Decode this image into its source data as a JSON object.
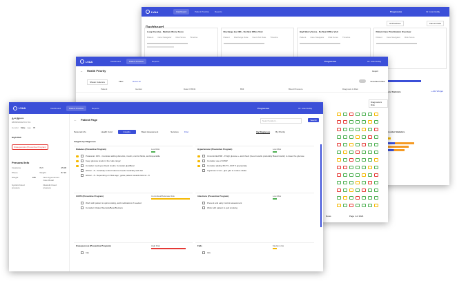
{
  "brand": "LVAA",
  "nav": {
    "dashboard": "Dashboard",
    "patient_practice": "Patient Practice",
    "reports": "Reports"
  },
  "org": {
    "name": "Progressive",
    "sub": "Progressive clinic"
  },
  "user": "Dr. Lisa Cuddy",
  "dashboard": {
    "title": "Dashboard",
    "filter": "All Practices",
    "btn": "Cancel Visits",
    "cards": [
      {
        "title": "Long Overdue - Medium Worry Score",
        "cols": [
          "Patient",
          "Care Navigator",
          "Risk Score",
          "Timeline"
        ]
      },
      {
        "title": "Discharge last 48h - No Next Office Visit",
        "cols": [
          "Patient",
          "Discharge Date",
          "Next Visit Date",
          "Timeline"
        ]
      },
      {
        "title": "High Worry Score - No Next Office Visit",
        "cols": [
          "Patient",
          "Care Navigator",
          "Risk Score",
          "Timeline"
        ]
      },
      {
        "title": "Patient Care Prioritization Overview",
        "cols": [
          "Patient",
          "Care Navigator",
          "Risk Score",
          "Timeline"
        ]
      }
    ],
    "care_stats": "Care Statistics",
    "add_widget": "+ Add Widget",
    "provider_stats": "Provider Statistics"
  },
  "health_priority": {
    "title": "Health Priority",
    "export": "Export",
    "shown_columns": "Shown Columns",
    "filter": "Filter",
    "reset": "Reset all",
    "simulated": "Simulated Value",
    "columns": [
      "Patient",
      "Gender",
      "Date Of Birth",
      "BMI",
      "Blood Pressure",
      "Diagnosis & Risk"
    ],
    "diag_risk": "Diagnosis & Risk",
    "rows": "Rows",
    "pager": "Page 1 of 1024"
  },
  "patient": {
    "page_title": "Patient Page",
    "search_placeholder": "Search patient...",
    "search_btn": "Search",
    "name": "A** Bl****",
    "id": "#8568520327FC791",
    "gender_label": "Gender",
    "gender": "Male",
    "age_label": "Age",
    "age": "76",
    "risk_label": "High Risk",
    "program": "Osteoporosis (Preventive Program)",
    "personal_info": "Personal Info",
    "info": [
      {
        "k": "Insurance",
        "v": "",
        "k2": "BMI",
        "v2": "25.08"
      },
      {
        "k": "Phone",
        "v": "",
        "k2": "Weight",
        "v2": "87.26"
      },
      {
        "k": "Weight",
        "v": "188",
        "k2": "Next Appointment Care Model",
        "v2": ""
      },
      {
        "k": "Systolic blood pressure",
        "v": "",
        "k2": "Diastolic blood pressure",
        "v2": ""
      }
    ],
    "tabs": [
      "Personal info",
      "Health Card",
      "Insights",
      "Basic Assessment",
      "Services"
    ],
    "tab_filter": "Filter",
    "by_diagnoses": "By Diagnoses",
    "by_priority": "By Priority",
    "insights_title": "Insights by Diagnoses",
    "panels": [
      {
        "title": "Diabetes (Preventive Program)",
        "level": "Low Risk",
        "items": [
          "Potassium 10% - Consider adding diuretics, insulin, control fluids, and Especiallie",
          "Keep glucose levels in the 'safe range'",
          "Consider moving to blood insulin. Consider glaciBanz",
          "HbA1c - 8 - Carefully control Glucose levels medically and diet",
          "HbA1c - 8 - Depending on 'Risk age', guide patient towards HbA1c - 8"
        ],
        "color": "#4caf50"
      },
      {
        "title": "Hypertension (Preventive Program)",
        "level": "Low Risk",
        "items": [
          "Uncontrolled BM - If high glucose + add check (Good results preferably Basal Insulin) to lower the glucose",
          "Consider use of CPAP",
          "Consider adding 5th TC, DOT if appropriate",
          "If glucose is low - give glut to reduce intake"
        ],
        "color": "#4caf50"
      },
      {
        "title": "COPD (Preventive Program)",
        "level": "Controlled/Moderate Risk",
        "items": [
          "Work with patient to quit smoking, add medications if needed",
          "Consider Inhaled Steroids/Beta Blockers"
        ],
        "color": "#f5b800"
      },
      {
        "title": "Infections (Preventive Program)",
        "level": "Low Risk",
        "items": [
          "Prevent and early control assessment",
          "Work with patient to quit smoking"
        ],
        "color": "#4caf50"
      },
      {
        "title": "Osteoporosis (Preventive Program)",
        "level": "High Risk",
        "items": [
          "Info"
        ],
        "color": "#e53935"
      },
      {
        "title": "Falls",
        "level": "Medium risk",
        "items": [
          "Info"
        ],
        "color": "#f5b800"
      }
    ]
  },
  "colors": {
    "topbar": "#3b4fd8",
    "accent": "#3b4fd8",
    "green": "#4caf50",
    "red": "#e53935",
    "amber": "#f5b800",
    "orange": "#f59a23"
  }
}
